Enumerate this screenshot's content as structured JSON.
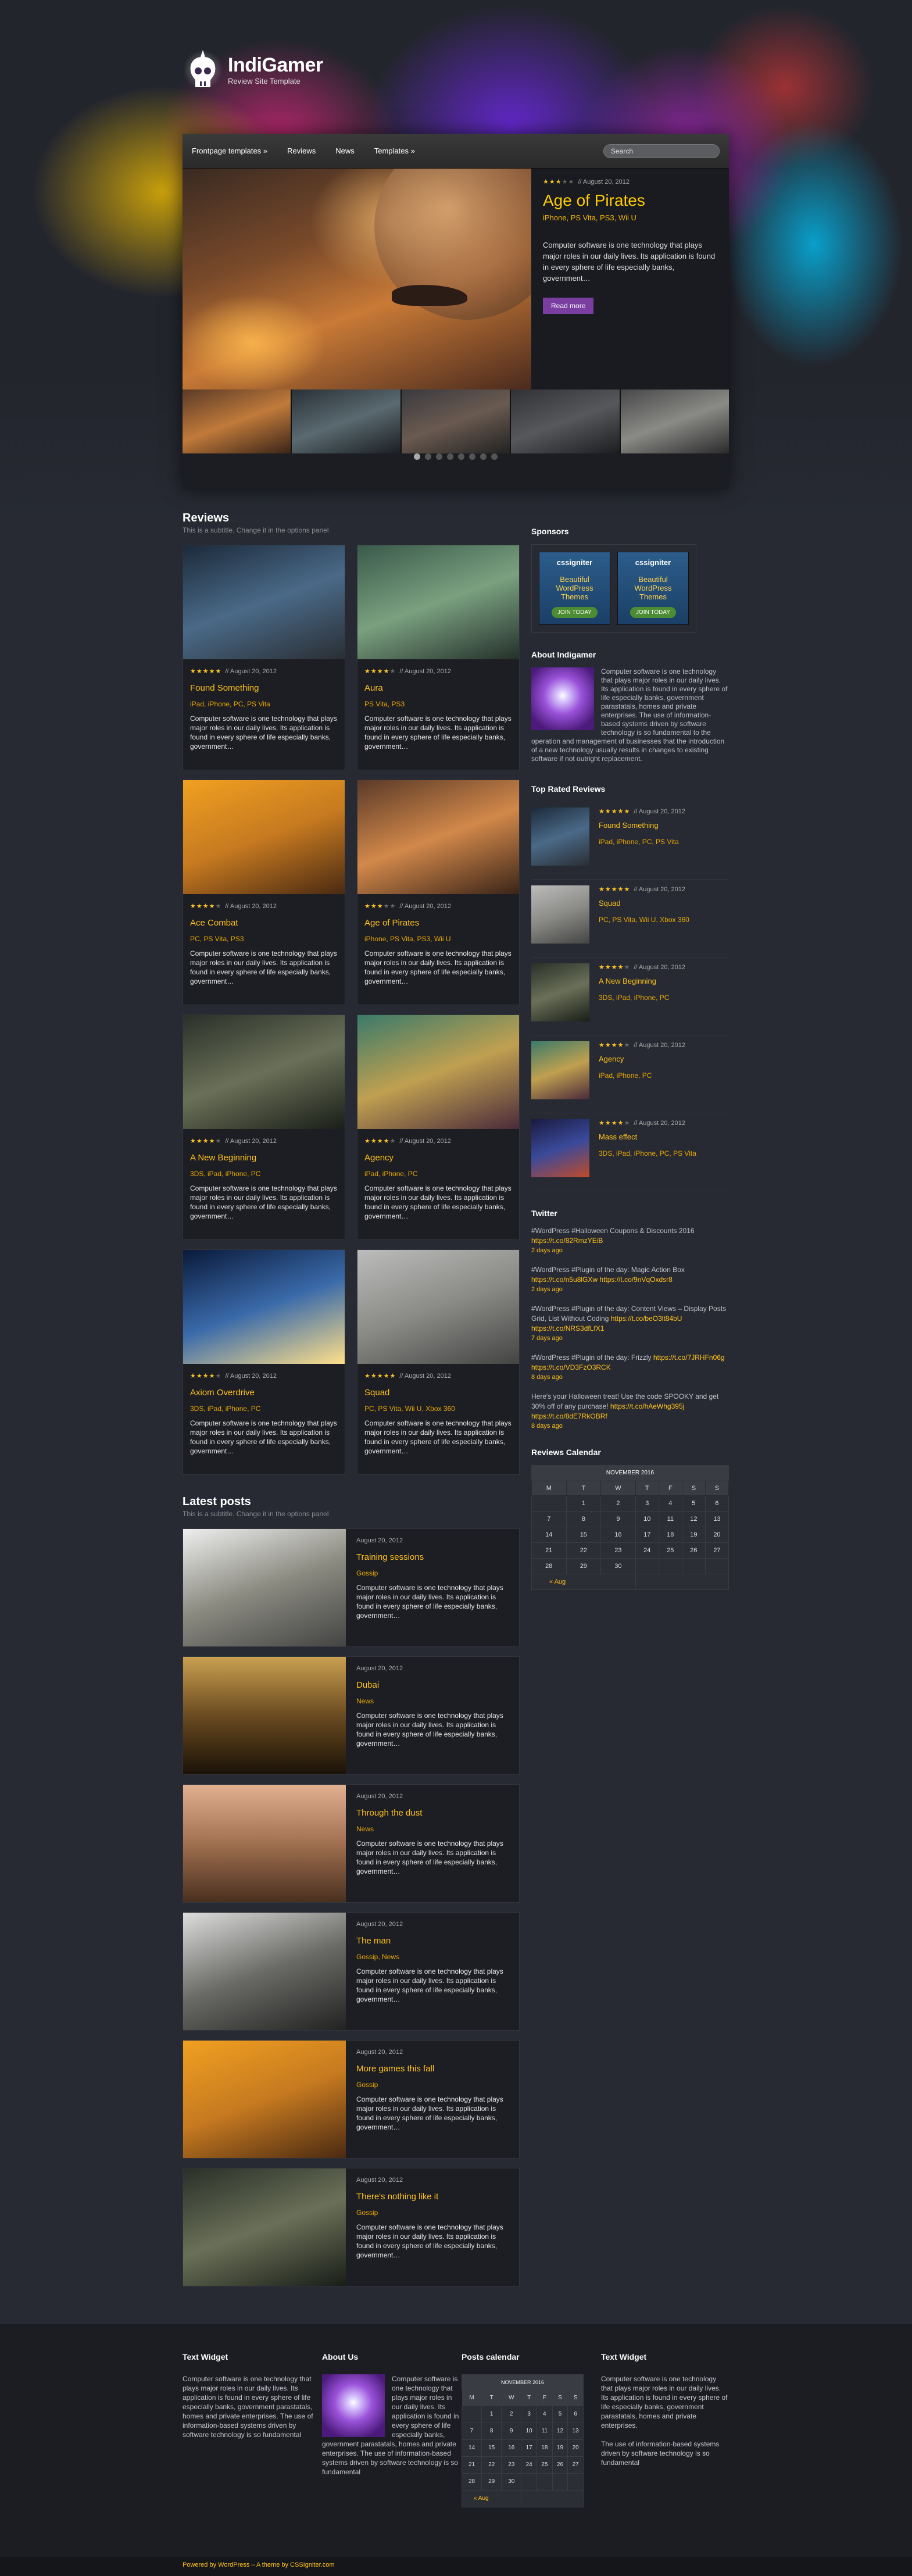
{
  "brand": {
    "name": "IndiGamer",
    "subtitle": "Review Site Template"
  },
  "nav": {
    "items": [
      "Frontpage templates »",
      "Reviews",
      "News",
      "Templates »"
    ],
    "search_placeholder": "Search"
  },
  "slider": {
    "date": "// August 20, 2012",
    "rating": 3,
    "title": "Age of Pirates",
    "tags": "iPhone, PS Vita, PS3, Wii U",
    "text": "Computer software is one technology that plays major roles in our daily lives. Its application is found in every sphere of life especially banks, government…",
    "button": "Read more"
  },
  "reviews": {
    "title": "Reviews",
    "subtitle": "This is a subtitle. Change it in the options panel",
    "items": [
      {
        "title": "Found Something",
        "date": "// August 20, 2012",
        "rating": 5,
        "tags": "iPad, iPhone, PC, PS Vita",
        "text": "Computer software is one technology that plays major roles in our daily lives. Its application is found in every sphere of life especially banks, government…"
      },
      {
        "title": "Aura",
        "date": "// August 20, 2012",
        "rating": 4,
        "tags": "PS Vita, PS3",
        "text": "Computer software is one technology that plays major roles in our daily lives. Its application is found in every sphere of life especially banks, government…"
      },
      {
        "title": "Ace Combat",
        "date": "// August 20, 2012",
        "rating": 4,
        "tags": "PC, PS Vita, PS3",
        "text": "Computer software is one technology that plays major roles in our daily lives. Its application is found in every sphere of life especially banks, government…"
      },
      {
        "title": "Age of Pirates",
        "date": "// August 20, 2012",
        "rating": 3,
        "tags": "iPhone, PS Vita, PS3, Wii U",
        "text": "Computer software is one technology that plays major roles in our daily lives. Its application is found in every sphere of life especially banks, government…"
      },
      {
        "title": "A New Beginning",
        "date": "// August 20, 2012",
        "rating": 4,
        "tags": "3DS, iPad, iPhone, PC",
        "text": "Computer software is one technology that plays major roles in our daily lives. Its application is found in every sphere of life especially banks, government…"
      },
      {
        "title": "Agency",
        "date": "// August 20, 2012",
        "rating": 4,
        "tags": "iPad, iPhone, PC",
        "text": "Computer software is one technology that plays major roles in our daily lives. Its application is found in every sphere of life especially banks, government…"
      },
      {
        "title": "Axiom Overdrive",
        "date": "// August 20, 2012",
        "rating": 4,
        "tags": "3DS, iPad, iPhone, PC",
        "text": "Computer software is one technology that plays major roles in our daily lives. Its application is found in every sphere of life especially banks, government…"
      },
      {
        "title": "Squad",
        "date": "// August 20, 2012",
        "rating": 5,
        "tags": "PC, PS Vita, Wii U, Xbox 360",
        "text": "Computer software is one technology that plays major roles in our daily lives. Its application is found in every sphere of life especially banks, government…"
      }
    ]
  },
  "latest": {
    "title": "Latest posts",
    "subtitle": "This is a subtitle. Change it in the options panel",
    "items": [
      {
        "title": "Training sessions",
        "date": "August 20, 2012",
        "cat": "Gossip",
        "text": "Computer software is one technology that plays major roles in our daily lives. Its application is found in every sphere of life especially banks, government…"
      },
      {
        "title": "Dubai",
        "date": "August 20, 2012",
        "cat": "News",
        "text": "Computer software is one technology that plays major roles in our daily lives. Its application is found in every sphere of life especially banks, government…"
      },
      {
        "title": "Through the dust",
        "date": "August 20, 2012",
        "cat": "News",
        "text": "Computer software is one technology that plays major roles in our daily lives. Its application is found in every sphere of life especially banks, government…"
      },
      {
        "title": "The man",
        "date": "August 20, 2012",
        "cat": "Gossip, News",
        "text": "Computer software is one technology that plays major roles in our daily lives. Its application is found in every sphere of life especially banks, government…"
      },
      {
        "title": "More games this fall",
        "date": "August 20, 2012",
        "cat": "Gossip",
        "text": "Computer software is one technology that plays major roles in our daily lives. Its application is found in every sphere of life especially banks, government…"
      },
      {
        "title": "There's nothing like it",
        "date": "August 20, 2012",
        "cat": "Gossip",
        "text": "Computer software is one technology that plays major roles in our daily lives. Its application is found in every sphere of life especially banks, government…"
      }
    ]
  },
  "sidebar": {
    "sponsors_title": "Sponsors",
    "sponsor": {
      "logo": "cssigniter",
      "text": "Beautiful WordPress Themes",
      "button": "JOIN TODAY"
    },
    "about_title": "About Indigamer",
    "about_text": "Computer software is one technology that plays major roles in our daily lives. Its application is found in every sphere of life especially banks, government parastatals, homes and private enterprises. The use of information-based systems driven by software technology is so fundamental to the operation and management of businesses that the introduction of a new technology usually results in changes to existing software if not outright replacement.",
    "top_title": "Top Rated Reviews",
    "top": [
      {
        "title": "Found Something",
        "date": "// August 20, 2012",
        "rating": 5,
        "tags": "iPad, iPhone, PC, PS Vita"
      },
      {
        "title": "Squad",
        "date": "// August 20, 2012",
        "rating": 5,
        "tags": "PC, PS Vita, Wii U, Xbox 360"
      },
      {
        "title": "A New Beginning",
        "date": "// August 20, 2012",
        "rating": 4,
        "tags": "3DS, iPad, iPhone, PC"
      },
      {
        "title": "Agency",
        "date": "// August 20, 2012",
        "rating": 4,
        "tags": "iPad, iPhone, PC"
      },
      {
        "title": "Mass effect",
        "date": "// August 20, 2012",
        "rating": 4,
        "tags": "3DS, iPad, iPhone, PC, PS Vita"
      }
    ],
    "twitter_title": "Twitter",
    "tweets": [
      {
        "text": "#WordPress #Halloween Coupons & Discounts 2016",
        "link": "https://t.co/82RmzYEiB",
        "ago": "2 days ago"
      },
      {
        "text": "#WordPress #Plugin of the day: Magic Action Box",
        "link": "https://t.co/n5u8lGXw https://t.co/9nVqOxdsr8",
        "ago": "2 days ago"
      },
      {
        "text": "#WordPress #Plugin of the day: Content Views – Display Posts Grid, List Without Coding",
        "link": "https://t.co/beO3lt84bU https://t.co/NRS3dfLfX1",
        "ago": "7 days ago"
      },
      {
        "text": "#WordPress #Plugin of the day: Frizzly",
        "link": "https://t.co/7JRHFn06g https://t.co/VD3FzO3RCK",
        "ago": "8 days ago"
      },
      {
        "text": "Here's your Halloween treat! Use the code SPOOKY and get 30% off of any purchase!",
        "link": "https://t.co/hAeWhg395j https://t.co/8dE7RkOBRf",
        "ago": "8 days ago"
      }
    ],
    "calendar_title": "Reviews Calendar"
  },
  "calendar": {
    "month": "NOVEMBER 2016",
    "days": [
      "M",
      "T",
      "W",
      "T",
      "F",
      "S",
      "S"
    ],
    "weeks": [
      [
        "",
        "1",
        "2",
        "3",
        "4",
        "5",
        "6"
      ],
      [
        "7",
        "8",
        "9",
        "10",
        "11",
        "12",
        "13"
      ],
      [
        "14",
        "15",
        "16",
        "17",
        "18",
        "19",
        "20"
      ],
      [
        "21",
        "22",
        "23",
        "24",
        "25",
        "26",
        "27"
      ],
      [
        "28",
        "29",
        "30",
        "",
        "",
        "",
        ""
      ]
    ],
    "prev": "« Aug"
  },
  "footer": {
    "text_widget_title": "Text Widget",
    "text_widget": "Computer software is one technology that plays major roles in our daily lives. Its application is found in every sphere of life especially banks, government parastatals, homes and private enterprises. The use of information-based systems driven by software technology is so fundamental",
    "about_title": "About Us",
    "about_text": "Computer software is one technology that plays major roles in our daily lives. Its application is found in every sphere of life especially banks, government parastatals, homes and private enterprises. The use of information-based systems driven by software technology is so fundamental",
    "calendar_title": "Posts calendar",
    "text_widget2_title": "Text Widget",
    "text_widget2a": "Computer software is one technology that plays major roles in our daily lives. Its application is found in every sphere of life especially banks, government parastatals, homes and private enterprises.",
    "text_widget2b": "The use of information-based systems driven by software technology is so fundamental",
    "copyright": "Powered by WordPress – A theme by CSSIgniter.com"
  },
  "colors": {
    "accent": "#ffc21a",
    "purple": "#7a3ea0",
    "bg": "#272a33"
  }
}
